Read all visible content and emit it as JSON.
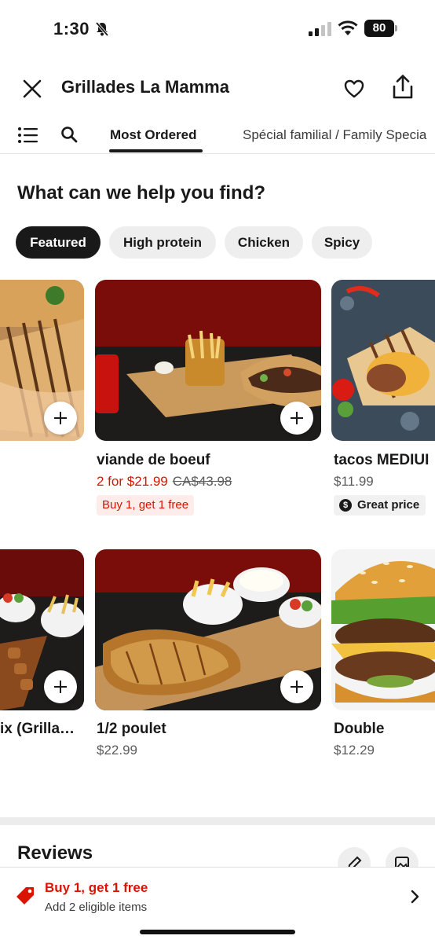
{
  "status_bar": {
    "time": "1:30",
    "battery": "80"
  },
  "header": {
    "title": "Grillades La Mamma"
  },
  "tabs": [
    {
      "label": "Most Ordered",
      "active": true
    },
    {
      "label": "Spécial familial / Family Specia",
      "active": false
    }
  ],
  "section": {
    "heading": "What can we help you find?"
  },
  "chips": [
    {
      "label": "Featured",
      "active": true
    },
    {
      "label": "High protein",
      "active": false
    },
    {
      "label": "Chicken",
      "active": false
    },
    {
      "label": "Spicy",
      "active": false
    }
  ],
  "row1": [
    {
      "name": "",
      "price": ""
    },
    {
      "name": "viande de boeuf",
      "price": "2 for $21.99",
      "original_price": "CA$43.98",
      "badge": "Buy 1, get 1 free"
    },
    {
      "name": "tacos MEDIUI",
      "price": "$11.99",
      "badge": "Great price"
    }
  ],
  "row2": [
    {
      "name": "ix (Grilla…",
      "price": ""
    },
    {
      "name": "1/2 poulet",
      "price": "$22.99"
    },
    {
      "name": "Double",
      "price": "$12.29"
    }
  ],
  "reviews": {
    "heading": "Reviews"
  },
  "promo": {
    "title": "Buy 1, get 1 free",
    "subtitle": "Add 2 eligible items"
  },
  "colors": {
    "accent_red": "#d91400",
    "dark": "#191919",
    "chip_bg": "#eeeeee"
  },
  "icons": [
    "bell-slash-icon",
    "signal-icon",
    "wifi-icon",
    "battery-icon",
    "close-icon",
    "heart-icon",
    "share-icon",
    "list-icon",
    "search-icon",
    "plus-icon",
    "dollar-icon",
    "pencil-icon",
    "image-icon",
    "tag-icon",
    "chevron-right-icon"
  ]
}
